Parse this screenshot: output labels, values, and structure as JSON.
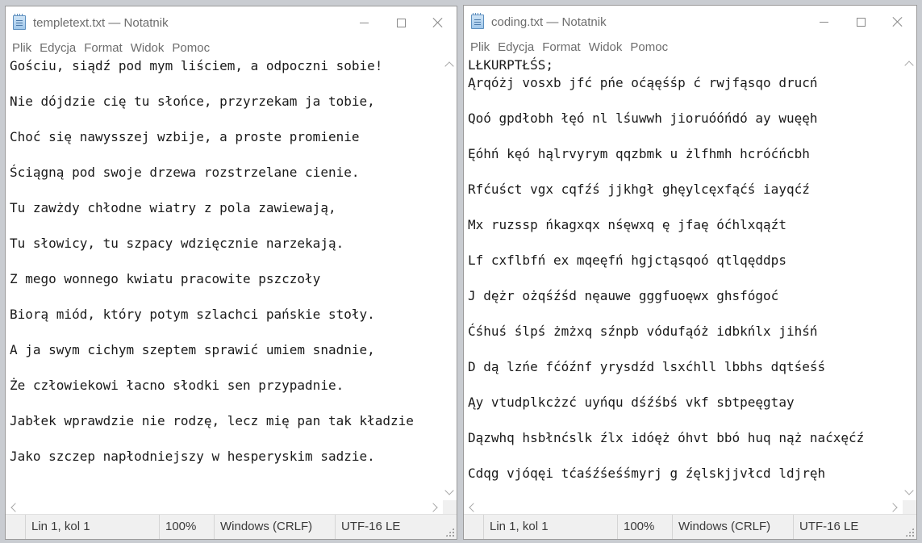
{
  "windows": [
    {
      "title": "templetext.txt — Notatnik",
      "menu": [
        "Plik",
        "Edycja",
        "Format",
        "Widok",
        "Pomoc"
      ],
      "lines": [
        "Gościu, siądź pod mym liściem, a odpoczni sobie!",
        "Nie dójdzie cię tu słońce, przyrzekam ja tobie,",
        "Choć się nawysszej wzbije, a proste promienie",
        "Ściągną pod swoje drzewa rozstrzelane cienie.",
        "Tu zawżdy chłodne wiatry z pola zawiewają,",
        "Tu słowicy, tu szpacy wdzięcznie narzekają.",
        "Z mego wonnego kwiatu pracowite pszczoły",
        "Biorą miód, który potym szlachci pańskie stoły.",
        "A ja swym cichym szeptem sprawić umiem snadnie,",
        "Że człowiekowi łacno słodki sen przypadnie.",
        "Jabłek wprawdzie nie rodzę, lecz mię pan tak kładzie",
        "Jako szczep napłodniejszy w hesperyskim sadzie."
      ],
      "status": {
        "position": "Lin 1, kol 1",
        "zoom": "100%",
        "line_ending": "Windows (CRLF)",
        "encoding": "UTF-16 LE"
      }
    },
    {
      "title": "coding.txt — Notatnik",
      "menu": [
        "Plik",
        "Edycja",
        "Format",
        "Widok",
        "Pomoc"
      ],
      "lines": [
        "LŁKURPTŁŚS;",
        "Ąrqóżj vosxb jfć pńe oćąęśśp ć rwjfąsqo drucń",
        "Qoó gpdłobh łęó nl lśuwwh jioruóóńdó ay wuęęh",
        "Ęóhń kęó hąlrvyrym qqzbmk u żlfhmh hcróćńcbh",
        "Rfćuśct vgx cqfźś jjkhgł ghęylcęxfąćś iayqćź",
        "Mx ruzssp ńkagxqx nśęwxq ę jfaę óćhlxqąźt",
        "Lf cxflbfń ex mqeęfń hgjctąsqoó qtlqęddps",
        "J dężr ożqśźśd nęauwe gggfuoęwx ghsfógoć",
        "Ćśhuś ślpś żmżxq sźnpb vódufąóż idbkńlx jihśń",
        "D dą lzńe fćóźnf yrysdźd lsxćhll lbbhs dqtśeśś",
        "Ąy vtudplkcżzć uyńqu dśźśbś vkf sbtpeęgtay",
        "Dązwhq hsbłnćslk źlx idóęż óhvt bbó huq nąż naćxęćź",
        "Cdqg vjóqęi tćaśźśeśśmyrj g źęlskjjvłcd ldjręh"
      ],
      "status": {
        "position": "Lin 1, kol 1",
        "zoom": "100%",
        "line_ending": "Windows (CRLF)",
        "encoding": "UTF-16 LE"
      }
    }
  ],
  "icons": {
    "app": "notepad-icon",
    "minimize": "minimize-icon",
    "maximize": "maximize-icon",
    "close": "close-icon"
  }
}
